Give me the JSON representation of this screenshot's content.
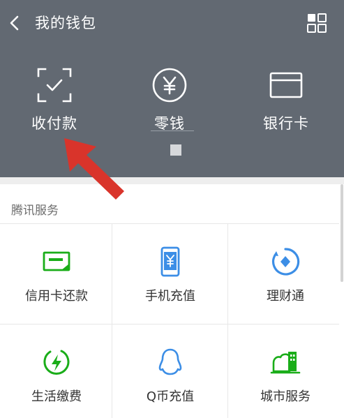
{
  "header": {
    "title": "我的钱包"
  },
  "actions": [
    {
      "label": "收付款",
      "icon": "scan-pay-icon"
    },
    {
      "label": "零钱",
      "icon": "yen-circle-icon"
    },
    {
      "label": "银行卡",
      "icon": "bank-card-icon"
    }
  ],
  "section": {
    "title": "腾讯服务"
  },
  "services": [
    {
      "label": "信用卡还款",
      "icon": "credit-card-repay-icon"
    },
    {
      "label": "手机充值",
      "icon": "phone-topup-icon"
    },
    {
      "label": "理财通",
      "icon": "wealth-icon"
    },
    {
      "label": "生活缴费",
      "icon": "utility-bill-icon"
    },
    {
      "label": "Q币充值",
      "icon": "qcoin-icon"
    },
    {
      "label": "城市服务",
      "icon": "city-service-icon"
    }
  ],
  "colors": {
    "header_bg": "#626972",
    "accent_green": "#1aad19",
    "accent_blue": "#3c8ee6",
    "annotation_arrow": "#d9342b"
  }
}
